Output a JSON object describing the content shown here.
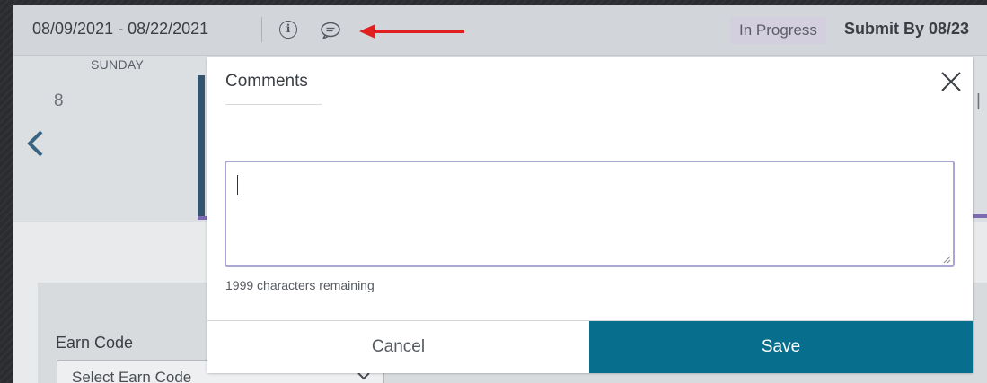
{
  "header": {
    "date_range": "08/09/2021 - 08/22/2021",
    "status": "In Progress",
    "submit_by": "Submit By 08/23",
    "icons": [
      "info-icon",
      "comment-icon"
    ]
  },
  "week": {
    "day_name": "SUNDAY",
    "day_number": "8"
  },
  "earn": {
    "label": "Earn Code",
    "select_value": "Select Earn Code"
  },
  "modal": {
    "title": "Comments",
    "comment_value": "",
    "chars_remaining": "1999 characters remaining",
    "cancel_label": "Cancel",
    "save_label": "Save"
  },
  "colors": {
    "save_button": "#076e8e",
    "annotation_arrow": "#e02020",
    "status_badge": "#d3cfdf",
    "column_marker": "#32546e"
  }
}
